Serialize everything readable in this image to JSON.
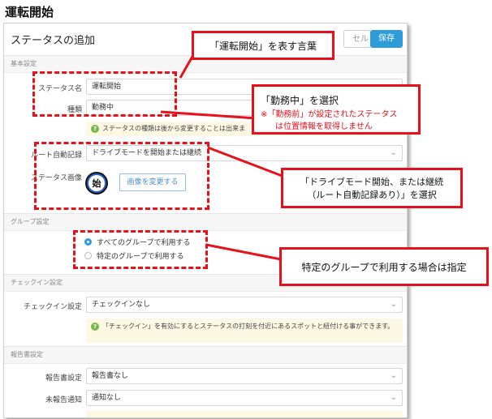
{
  "page_title": "運転開始",
  "dialog": {
    "title": "ステータスの追加",
    "cancel_label": "セル",
    "save_label": "保存"
  },
  "sections": {
    "basic": "基本設定",
    "group": "グループ設定",
    "checkin": "チェックイン設定",
    "report": "報告書設定"
  },
  "fields": {
    "status_name": {
      "label": "ステータス名",
      "value": "運転開始"
    },
    "kind": {
      "label": "種類",
      "value": "勤務中"
    },
    "kind_hint": "ステータスの種類は後から変更することは出来ま",
    "route": {
      "label": "ルート自動記録",
      "value": "ドライブモードを開始または継続"
    },
    "status_image": {
      "label": "ステータス画像",
      "icon_char": "始",
      "change_label": "画像を変更する"
    },
    "group_options": [
      "すべてのグループで利用する",
      "特定のグループで利用する"
    ],
    "group_selected": 0,
    "checkin": {
      "label": "チェックイン設定",
      "value": "チェックインなし"
    },
    "checkin_hint": "「チェックイン」を有効にするとステータスの打刻を付近にあるスポットと紐付ける事ができます。",
    "report_setting": {
      "label": "報告書設定",
      "value": "報告書なし"
    },
    "unreported": {
      "label": "未報告通知",
      "value": "通知なし"
    }
  },
  "callouts": {
    "c1": "「運転開始」を表す言葉",
    "c2_main": "「勤務中」を選択",
    "c2_sub1": "※「勤務前」が設定されたステータス",
    "c2_sub2": "は位置情報を取得しません",
    "c3_line1": "「ドライブモード開始、または継続",
    "c3_line2": "（ルート自動記録あり）」を選択",
    "c4": "特定のグループで利用する場合は指定"
  },
  "colors": {
    "accent": "#2f9bd8",
    "annotation_red": "#e8101a",
    "hint_bg": "#fdf8e4"
  }
}
